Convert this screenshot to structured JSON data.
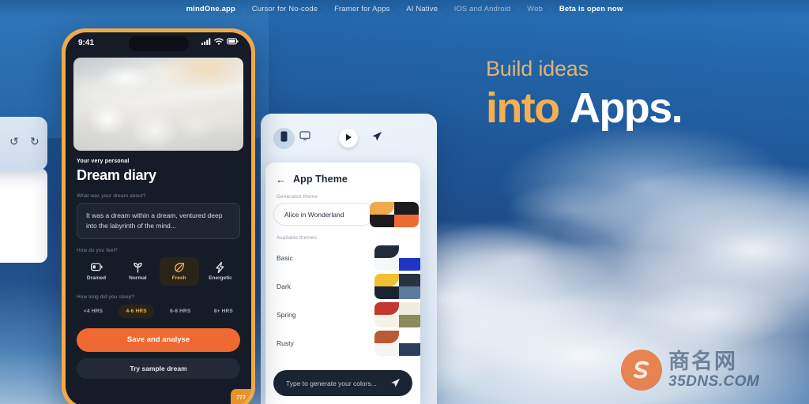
{
  "topnav": {
    "items": [
      {
        "label": "mindOne.app",
        "style": "bold"
      },
      {
        "label": "Cursor for No-code",
        "style": "normal"
      },
      {
        "label": "Framer for Apps",
        "style": "normal"
      },
      {
        "label": "AI Native",
        "style": "normal"
      },
      {
        "label": "iOS and Android",
        "style": "dim"
      },
      {
        "label": "Web",
        "style": "dim"
      },
      {
        "label": "Beta is open now",
        "style": "bold"
      }
    ],
    "separator": "·"
  },
  "headline": {
    "line1": "Build ideas",
    "line2_accent": "into",
    "line2_main": "Apps."
  },
  "phone": {
    "status": {
      "time": "9:41",
      "signal_icon": "signal-bars-icon",
      "wifi_icon": "wifi-icon",
      "battery_icon": "battery-icon"
    },
    "hero_image_alt": "cloud-bed-image",
    "kicker": "Your very personal",
    "title": "Dream diary",
    "dream_label": "What was your dream about?",
    "dream_text": "It was a dream within a dream, ventured deep into the labyrinth of the mind...",
    "feel_label": "How do you feel?",
    "moods": [
      {
        "label": "Drained",
        "icon": "battery-low-icon",
        "selected": false
      },
      {
        "label": "Normal",
        "icon": "sprout-icon",
        "selected": false
      },
      {
        "label": "Fresh",
        "icon": "leaf-icon",
        "selected": true
      },
      {
        "label": "Energetic",
        "icon": "lightning-bolt-icon",
        "selected": false
      }
    ],
    "sleep_label": "How long did you sleep?",
    "sleep_options": [
      {
        "label": "<4 HRS",
        "selected": false
      },
      {
        "label": "4-6 HRS",
        "selected": true
      },
      {
        "label": "6-8 HRS",
        "selected": false
      },
      {
        "label": "8+ HRS",
        "selected": false
      }
    ],
    "primary_button": "Save and analyse",
    "secondary_button": "Try sample dream",
    "corner_badge": "777"
  },
  "builder": {
    "toolbar": [
      {
        "icon": "mobile-device-icon",
        "selected": true
      },
      {
        "icon": "desktop-monitor-icon",
        "selected": false
      },
      {
        "icon": "play-icon",
        "selected": false
      },
      {
        "icon": "send-paper-plane-icon",
        "selected": false
      }
    ]
  },
  "theme_panel": {
    "back_icon": "arrow-left-icon",
    "title": "App Theme",
    "generated_label": "Generated theme",
    "generated_value": "Alice in Wonderland",
    "generated_swatch": [
      "#f0a94a",
      "#1c1c1c",
      "#1c1c1c",
      "#ef6a32"
    ],
    "available_label": "Available themes",
    "themes": [
      {
        "name": "Basic",
        "swatch": [
          "#222b3a",
          "#ffffff",
          "#f6f7f9",
          "#1e35c8"
        ]
      },
      {
        "name": "Dark",
        "swatch": [
          "#f2c031",
          "#2a3242",
          "#1b2230",
          "#5b7a9e"
        ]
      },
      {
        "name": "Spring",
        "swatch": [
          "#c4372c",
          "#f1ece0",
          "#f6f2e8",
          "#8d8a5c"
        ]
      },
      {
        "name": "Rusty",
        "swatch": [
          "#b85a36",
          "#ffffff",
          "#f7f5f2",
          "#2b3f5c"
        ]
      }
    ],
    "prompt_placeholder": "Type to generate your colors...",
    "prompt_send_icon": "send-paper-plane-icon"
  },
  "left_panel": {
    "undo_icon": "undo-arrow-icon",
    "redo_icon": "redo-arrow-icon"
  },
  "watermark": {
    "logo_icon": "brand-circle-icon",
    "cn_text": "商名网",
    "en_text": "35DNS.COM"
  }
}
